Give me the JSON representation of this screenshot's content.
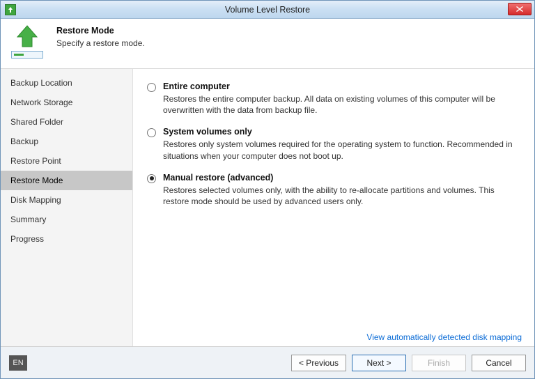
{
  "window": {
    "title": "Volume Level Restore"
  },
  "header": {
    "title": "Restore Mode",
    "subtitle": "Specify a restore mode."
  },
  "sidebar": {
    "items": [
      {
        "label": "Backup Location"
      },
      {
        "label": "Network Storage"
      },
      {
        "label": "Shared Folder"
      },
      {
        "label": "Backup"
      },
      {
        "label": "Restore Point"
      },
      {
        "label": "Restore Mode"
      },
      {
        "label": "Disk Mapping"
      },
      {
        "label": "Summary"
      },
      {
        "label": "Progress"
      }
    ],
    "selected_index": 5
  },
  "options": [
    {
      "id": "entire-computer",
      "title": "Entire computer",
      "desc": "Restores the entire computer backup. All data on existing volumes of this computer will be overwritten with the data from backup file.",
      "checked": false
    },
    {
      "id": "system-volumes",
      "title": "System volumes only",
      "desc": "Restores only system volumes required for the operating system to function. Recommended in situations when your computer does not boot up.",
      "checked": false
    },
    {
      "id": "manual-restore",
      "title": "Manual restore (advanced)",
      "desc": "Restores selected volumes only, with the ability to re-allocate partitions and volumes. This restore mode should be used by advanced users only.",
      "checked": true
    }
  ],
  "link": "View automatically detected disk mapping",
  "footer": {
    "lang": "EN",
    "previous": "< Previous",
    "next": "Next >",
    "finish": "Finish",
    "cancel": "Cancel"
  }
}
